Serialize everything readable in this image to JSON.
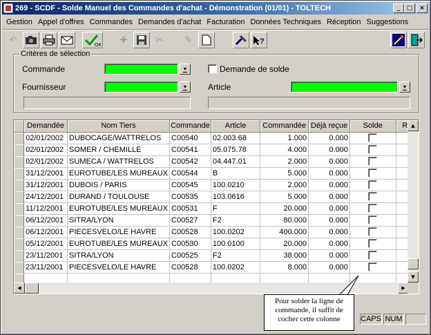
{
  "window": {
    "title": "269 - SCDF - Solde Manuel des Commandes d'achat - Démonstration (01/01) - TOLTECH"
  },
  "menu": [
    "Gestion",
    "Appel d'offres",
    "Commandes",
    "Demandes d'achat",
    "Facturation",
    "Données Techniques",
    "Réception",
    "Suggestions"
  ],
  "toolbar": {
    "buttons": [
      "back-icon",
      "camera-icon",
      "print-icon",
      "mail-icon",
      "validate-ok-icon",
      "add-icon",
      "save-icon",
      "cut-icon",
      "edit-icon",
      "new-doc-icon",
      "tools-icon",
      "help-icon",
      "magic-wand-icon",
      "exit-icon"
    ]
  },
  "criteria": {
    "title": "Critères de sélection",
    "commande_label": "Commande",
    "fournisseur_label": "Fournisseur",
    "demande_solde_label": "Demande de solde",
    "article_label": "Article"
  },
  "grid": {
    "columns": [
      "Demandée",
      "Nom Tiers",
      "Commande",
      "Article",
      "Commandée",
      "Déjà reçue",
      "Solde",
      "Re"
    ],
    "rows": [
      [
        "02/01/2002",
        "DUBOCAGE/WATTRELOS",
        "C00540",
        "02.003.68",
        "1.000",
        "0.000"
      ],
      [
        "02/01/2002",
        "SOMER / CHEMILLE",
        "C00541",
        "05.075.78",
        "4.000",
        "0.000"
      ],
      [
        "02/01/2002",
        "SUMECA / WATTRELOS",
        "C00542",
        "04.447.01",
        "2.000",
        "0.000"
      ],
      [
        "31/12/2001",
        "EUROTUBE/LES MUREAUX",
        "C00544",
        "B",
        "5.000",
        "0.000"
      ],
      [
        "31/12/2001",
        "DUBOIS / PARIS",
        "C00545",
        "100.0210",
        "2.000",
        "0.000"
      ],
      [
        "24/12/2001",
        "DURAND / TOULOUSE",
        "C00535",
        "103.0616",
        "5.000",
        "0.000"
      ],
      [
        "11/12/2001",
        "EUROTUBE/LES MUREAUX",
        "C00531",
        "F",
        "20.000",
        "0.000"
      ],
      [
        "06/12/2001",
        "SITRA/LYON",
        "C00527",
        "F2",
        "80.000",
        "0.000"
      ],
      [
        "06/12/2001",
        "PIECESVELO/LE HAVRE",
        "C00528",
        "100.0202",
        "400.000",
        "0.000"
      ],
      [
        "05/12/2001",
        "EUROTUBE/LES MUREAUX",
        "C00530",
        "100.0100",
        "20.000",
        "0.000"
      ],
      [
        "23/11/2001",
        "SITRA/LYON",
        "C00525",
        "F2",
        "38.000",
        "0.000"
      ],
      [
        "23/11/2001",
        "PIECESVELO/LE HAVRE",
        "C00528",
        "100.0202",
        "8.000",
        "0.000"
      ]
    ]
  },
  "callout": {
    "text": "Pour solder la ligne de commande, il suffit de cocher cette colonne"
  },
  "status": {
    "caps": "CAPS",
    "num": "NUM"
  }
}
